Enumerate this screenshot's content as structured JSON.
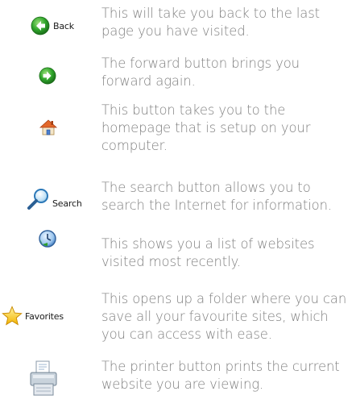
{
  "rows": [
    {
      "button_label": "Back",
      "icon": "back-arrow-icon",
      "description": "This will take you back to the last page you have visited."
    },
    {
      "button_label": "",
      "icon": "forward-arrow-icon",
      "description": "The forward button brings you forward again."
    },
    {
      "button_label": "",
      "icon": "home-icon",
      "description": "This button takes you to the homepage that is setup on your computer."
    },
    {
      "button_label": "Search",
      "icon": "search-magnifier-icon",
      "description": "The search button allows you to search the Internet for information."
    },
    {
      "button_label": "",
      "icon": "history-clock-icon",
      "description": "This shows you a list of websites visited most recently."
    },
    {
      "button_label": "Favorites",
      "icon": "favorites-star-icon",
      "description": "This opens up a folder where you can save all your favourite sites, which you can access with ease."
    },
    {
      "button_label": "",
      "icon": "printer-icon",
      "description": "The printer button prints the current website you are viewing."
    }
  ],
  "colors": {
    "description_text": "#7f7f7f",
    "button_label_text": "#1a1a1a",
    "arrow_green": "#2e9e2a",
    "star_yellow": "#f7c21a"
  }
}
